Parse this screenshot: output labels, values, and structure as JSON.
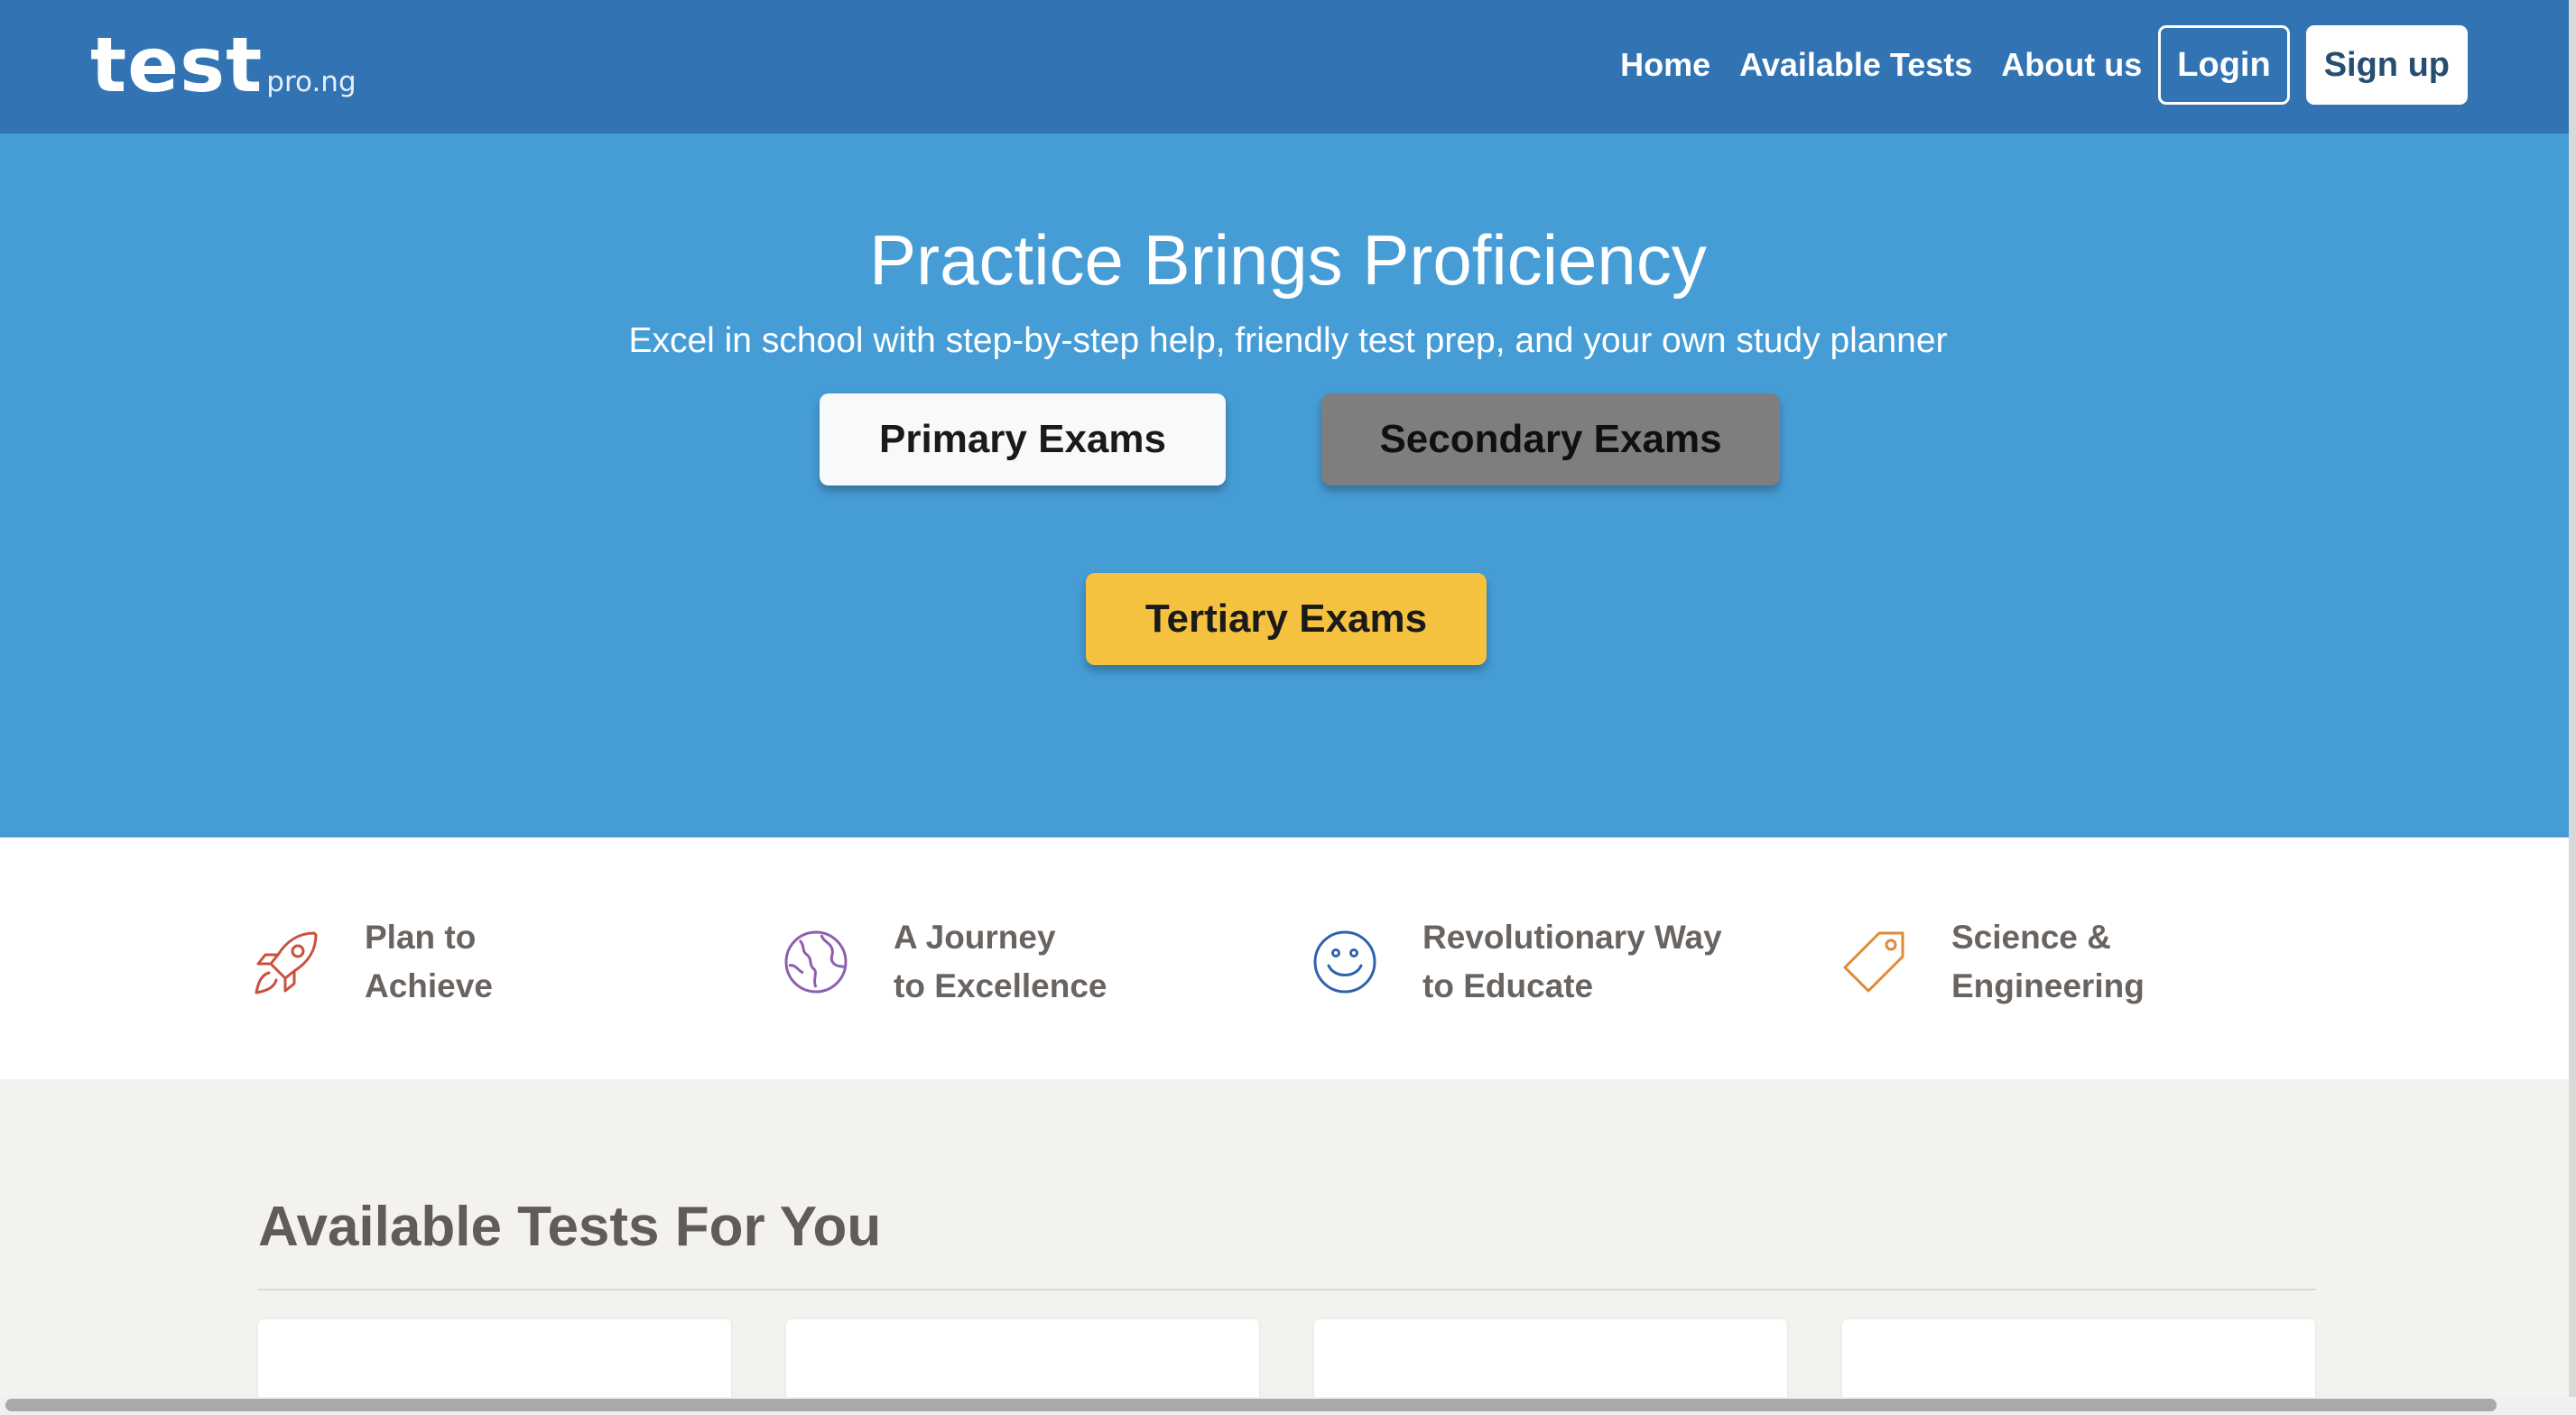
{
  "brand": {
    "logo_main": "test",
    "logo_sub": "pro.ng"
  },
  "nav": {
    "items": [
      "Home",
      "Available Tests",
      "About us"
    ],
    "login_label": "Login",
    "signup_label": "Sign up"
  },
  "hero": {
    "title": "Practice Brings Proficiency",
    "subtitle": "Excel in school with step-by-step help, friendly test prep, and your own study planner",
    "buttons": {
      "primary": "Primary Exams",
      "secondary": "Secondary Exams",
      "tertiary": "Tertiary Exams"
    }
  },
  "features": [
    {
      "icon": "rocket-icon",
      "color": "#c9503e",
      "label": "Plan to\nAchieve"
    },
    {
      "icon": "globe-icon",
      "color": "#8d5fb0",
      "label": "A Journey\nto Excellence"
    },
    {
      "icon": "smiley-icon",
      "color": "#2f63ad",
      "label": "Revolutionary Way\nto Educate"
    },
    {
      "icon": "tag-icon",
      "color": "#e08a36",
      "label": "Science &\nEngineering"
    }
  ],
  "tests": {
    "title": "Available Tests For You"
  },
  "colors": {
    "nav_bg": "#3274b3",
    "hero_bg": "#469dd6",
    "tertiary_btn": "#f4c23f",
    "secondary_btn": "#7e7e7e",
    "section_bg": "#f3f2ef"
  }
}
